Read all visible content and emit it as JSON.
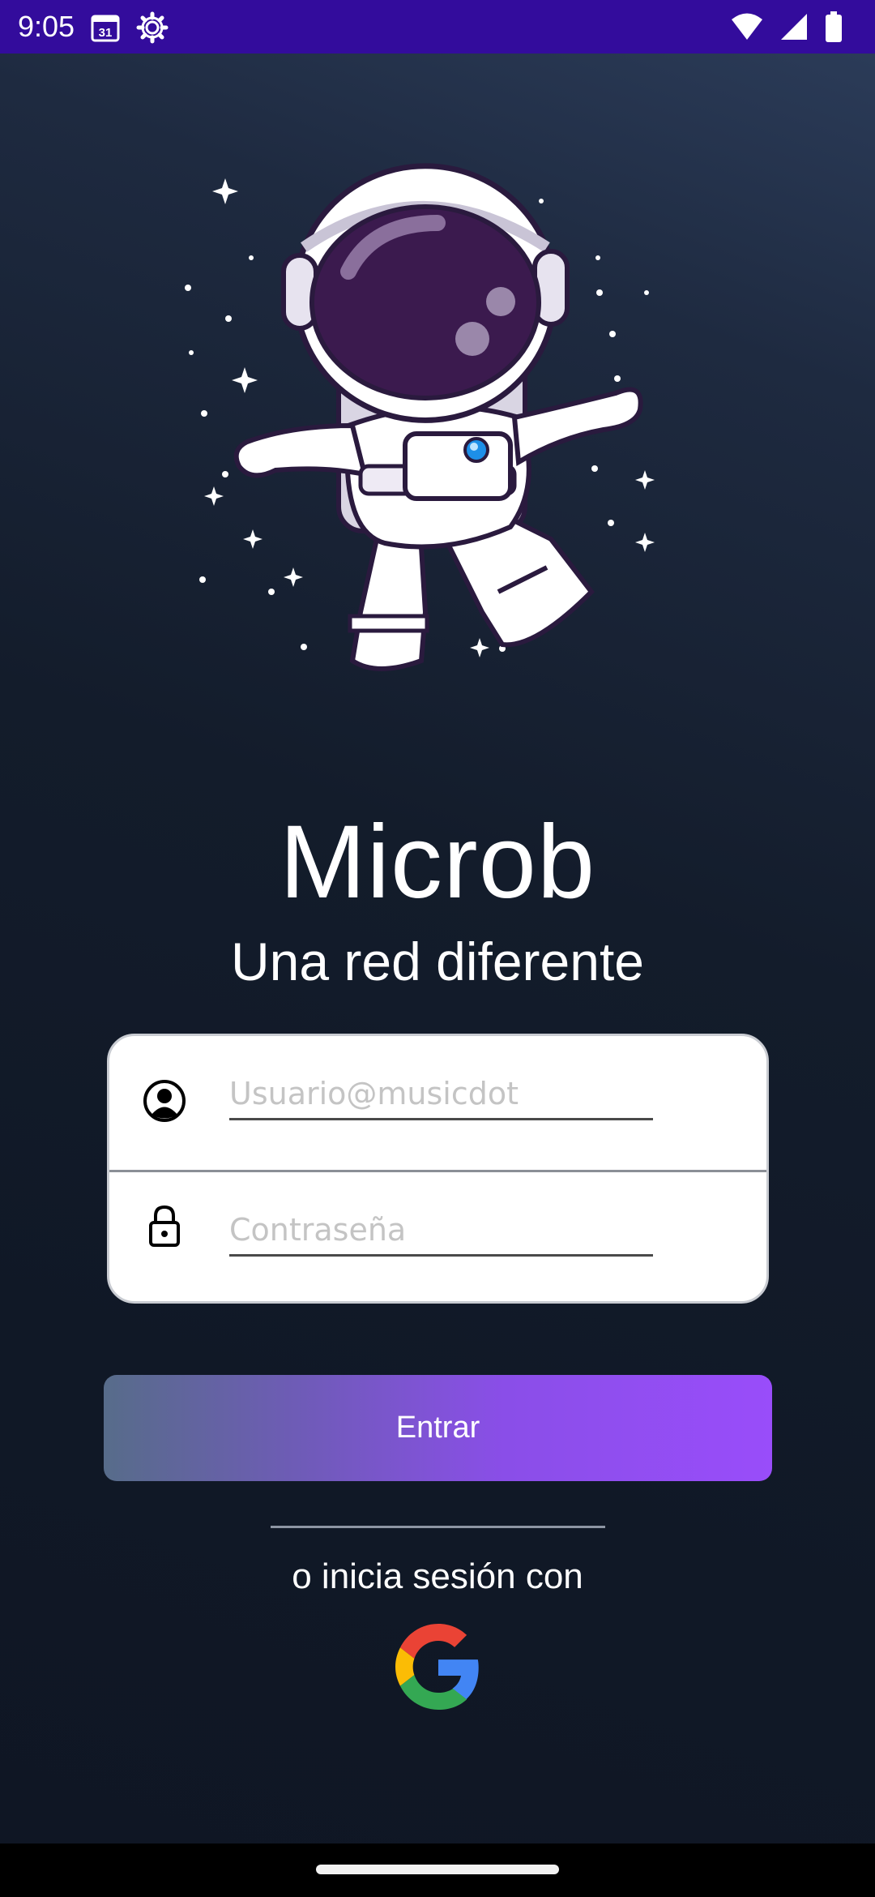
{
  "status_bar": {
    "time": "9:05",
    "calendar_day": "31",
    "icons": [
      "calendar-icon",
      "settings-gear-icon",
      "wifi-icon",
      "cellular-signal-icon",
      "battery-icon"
    ]
  },
  "app": {
    "title": "Microb",
    "subtitle": "Una red diferente"
  },
  "login_form": {
    "username": {
      "placeholder": "Usuario@musicdot",
      "value": "",
      "icon": "user-avatar-icon"
    },
    "password": {
      "placeholder": "Contraseña",
      "value": "",
      "icon": "lock-icon"
    },
    "submit_label": "Entrar"
  },
  "alt_login": {
    "label": "o inicia sesión con",
    "provider_icon": "google-icon"
  },
  "colors": {
    "status_bar": "#330c9c",
    "button_gradient_start": "#576c8a",
    "button_gradient_end": "#994dfa",
    "background_dark": "#101826"
  }
}
